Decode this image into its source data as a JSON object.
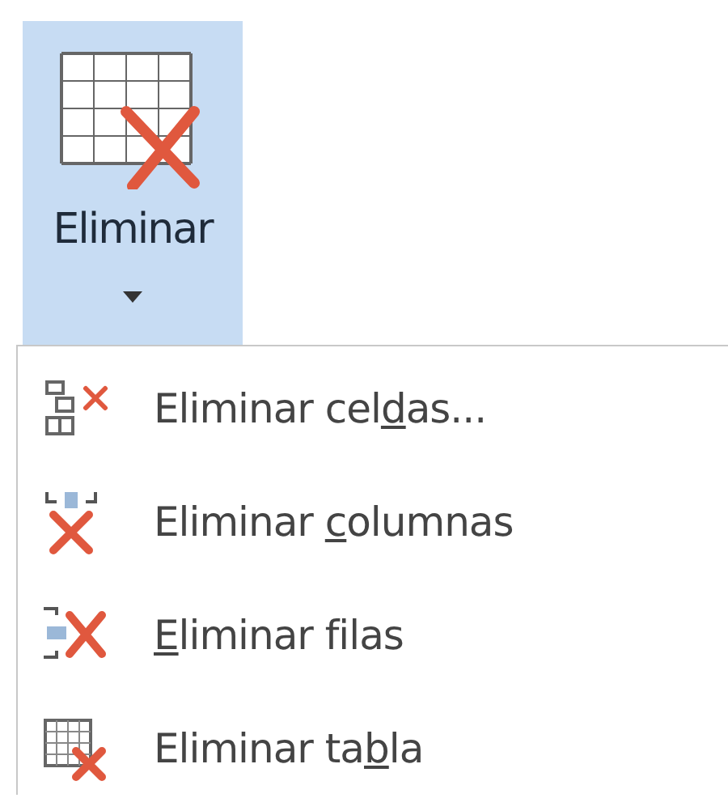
{
  "ribbon_button": {
    "label": "Eliminar",
    "expanded": true
  },
  "menu_items": [
    {
      "kind": "cells",
      "label": {
        "before": "Eliminar cel",
        "access_key": "d",
        "after": "as..."
      }
    },
    {
      "kind": "columns",
      "label": {
        "before": "Eliminar ",
        "access_key": "c",
        "after": "olumnas"
      }
    },
    {
      "kind": "rows",
      "label": {
        "access_key": "E",
        "after": "liminar filas"
      }
    },
    {
      "kind": "table",
      "label": {
        "before": "Eliminar ta",
        "access_key": "b",
        "after": "la"
      }
    }
  ]
}
